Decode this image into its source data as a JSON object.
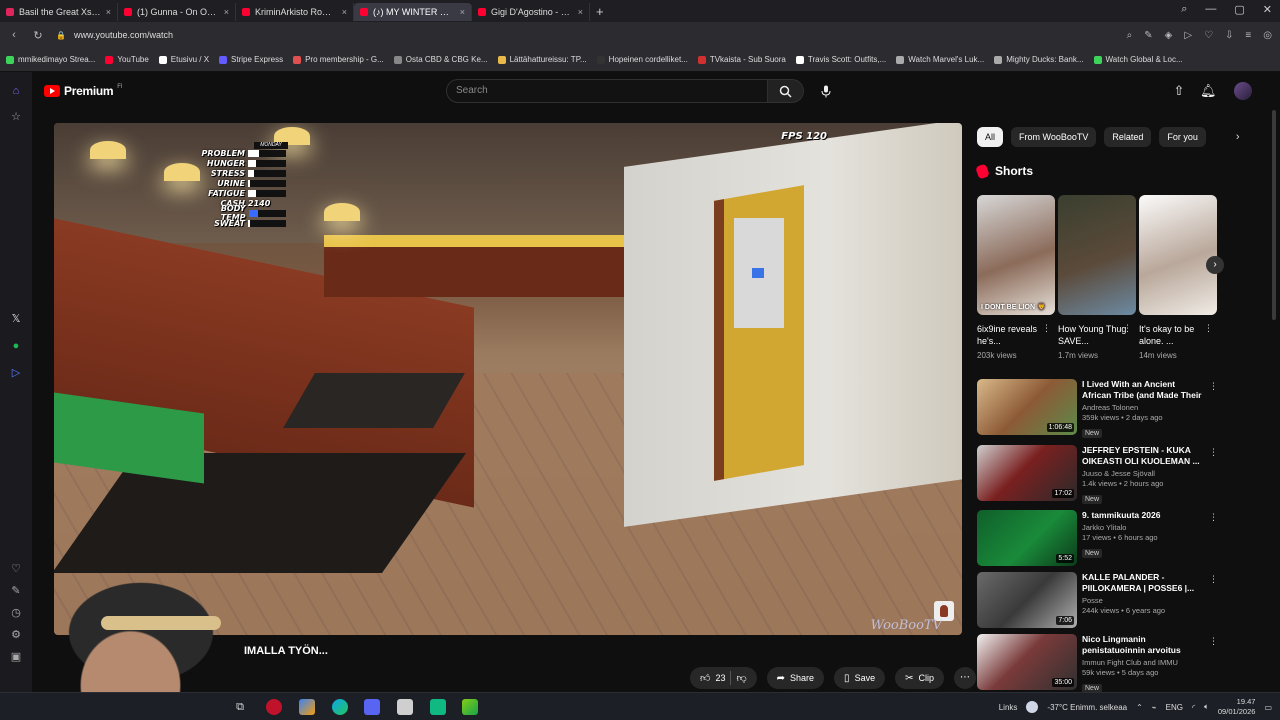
{
  "browser": {
    "tabs": [
      {
        "label": "Basil the Great Xssai: 'You",
        "color": "#e0245e",
        "active": false
      },
      {
        "label": "(1) Gunna - On One Tonig",
        "color": "#ff0033",
        "active": false
      },
      {
        "label": "KriminArkisto Romanien R",
        "color": "#ff0033",
        "active": false
      },
      {
        "label": "(♪) MY WINTER CAR - Au",
        "color": "#ff0033",
        "active": true
      },
      {
        "label": "Gigi D'Agostino - L'Amou",
        "color": "#ff0033",
        "active": false
      }
    ],
    "url": "www.youtube.com/watch",
    "bookmarks": [
      {
        "label": "mmikedimayo Strea...",
        "color": "#3dd45c"
      },
      {
        "label": "YouTube",
        "color": "#ff0033"
      },
      {
        "label": "Etusivu / X",
        "color": "#ffffff"
      },
      {
        "label": "Stripe Express",
        "color": "#635bff"
      },
      {
        "label": "Pro membership - G...",
        "color": "#e05050"
      },
      {
        "label": "Osta CBD & CBG Ke...",
        "color": "#888888"
      },
      {
        "label": "Lättähattureissu: TP...",
        "color": "#e8b84a"
      },
      {
        "label": "Hopeinen cordelliket...",
        "color": "#333333"
      },
      {
        "label": "TVkaista - Sub Suora",
        "color": "#d03030"
      },
      {
        "label": "Travis Scott: Outfits,...",
        "color": "#ffffff"
      },
      {
        "label": "Watch Marvel's Luk...",
        "color": "#aaaaaa"
      },
      {
        "label": "Mighty Ducks: Bank...",
        "color": "#aaaaaa"
      },
      {
        "label": "Watch Global & Loc...",
        "color": "#3dd45c"
      }
    ]
  },
  "youtube": {
    "logo": "Premium",
    "region": "FI",
    "search_placeholder": "Search"
  },
  "video": {
    "hud": [
      {
        "label": "PROBLEM",
        "level": 0.3
      },
      {
        "label": "HUNGER",
        "level": 0.2
      },
      {
        "label": "STRESS",
        "level": 0.15
      },
      {
        "label": "URINE",
        "level": 0.05
      },
      {
        "label": "FATIGUE",
        "level": 0.2
      },
      {
        "label": "CASH",
        "value": "2140"
      },
      {
        "label": "BODY TEMP",
        "level": 0.25
      },
      {
        "label": "SWEAT",
        "level": 0.05
      }
    ],
    "day": "MONDAY",
    "fps_label": "FPS 120",
    "watermark": "WooBooTV",
    "title_visible": "IMALLA TYÖN..."
  },
  "actions": {
    "likes": "23",
    "share": "Share",
    "save": "Save",
    "clip": "Clip"
  },
  "chips": [
    "All",
    "From WooBooTV",
    "Related",
    "For you"
  ],
  "shorts": {
    "heading": "Shorts",
    "items": [
      {
        "title": "6ix9ine reveals he's...",
        "views": "203k views",
        "caption": "I DONT BE LION 🦁"
      },
      {
        "title": "How Young Thug SAVE...",
        "views": "1.7m views",
        "caption": ""
      },
      {
        "title": "It's okay to be alone. ...",
        "views": "14m views",
        "caption": ""
      }
    ]
  },
  "recommendations": [
    {
      "title": "I Lived With an Ancient African Tribe (and Made Their Dream ...",
      "channel": "Andreas Tolonen",
      "views": "359k views • 2 days ago",
      "badge": "New",
      "duration": "1:06:48"
    },
    {
      "title": "JEFFREY EPSTEIN - KUKA OIKEASTI OLI KUOLEMAN ...",
      "channel": "Juuso & Jesse Sjövall",
      "views": "1.4k views • 2 hours ago",
      "badge": "New",
      "duration": "17:02"
    },
    {
      "title": "9. tammikuuta 2026",
      "channel": "Jarkko Ylitalo",
      "views": "17 views • 6 hours ago",
      "badge": "New",
      "duration": "5:52"
    },
    {
      "title": "KALLE PALANDER - PIILOKAMERA | POSSE6 |...",
      "channel": "Posse",
      "views": "244k views • 6 years ago",
      "badge": "",
      "duration": "7:06"
    },
    {
      "title": "Nico Lingmanin penistatuoinnin arvoitus ratkesi – Immu ...",
      "channel": "Immun Fight Club and IMMU",
      "views": "59k views • 5 days ago",
      "badge": "New",
      "duration": "35:00"
    }
  ],
  "taskbar": {
    "links": "Links",
    "weather": "-37°C Enimm. selkeaa",
    "lang": "ENG",
    "time": "19.47",
    "date": "09/01/2026"
  }
}
